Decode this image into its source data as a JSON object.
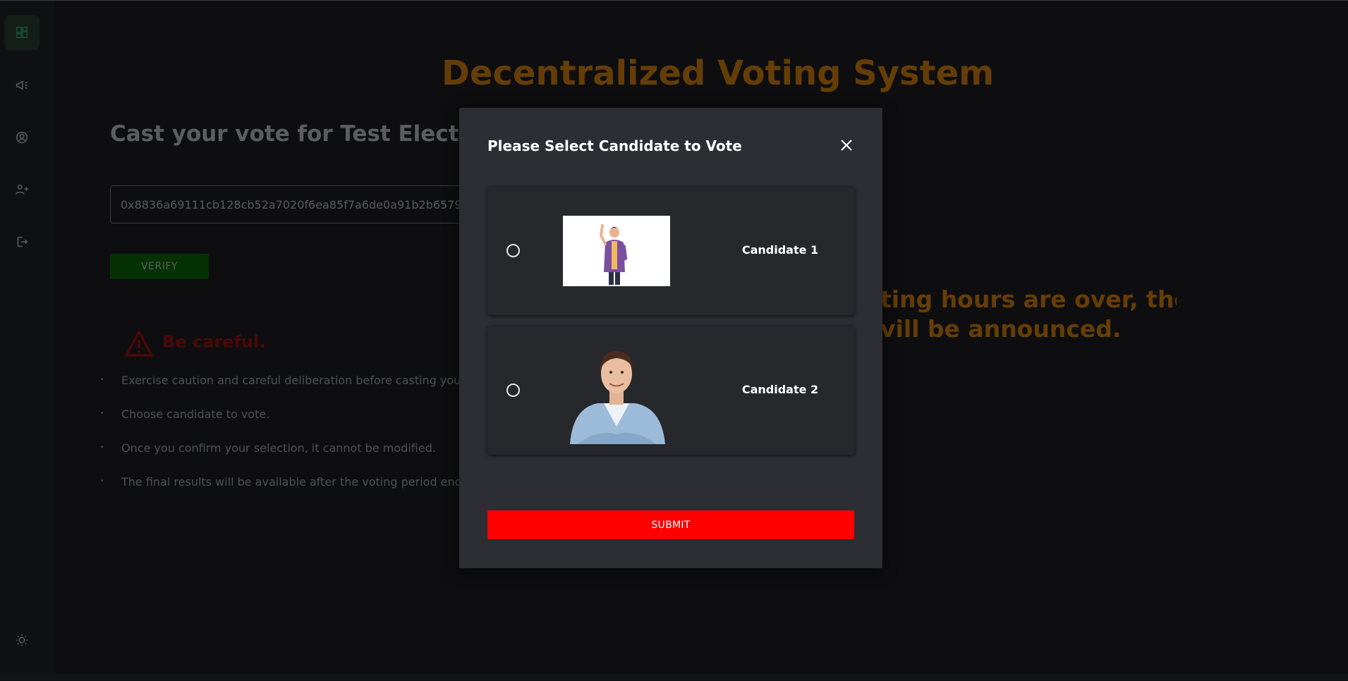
{
  "sidebar": {
    "items": [
      {
        "icon": "dashboard-icon",
        "active": true
      },
      {
        "icon": "megaphone-icon"
      },
      {
        "icon": "user-circle-icon"
      },
      {
        "icon": "add-user-icon"
      },
      {
        "icon": "logout-icon"
      }
    ],
    "theme_toggle_icon": "sun-icon"
  },
  "page": {
    "title": "Decentralized Voting System",
    "cast_title": "Cast your vote for Test Election",
    "token_value": "0x8836a69111cb128cb52a7020f6ea85f7a6de0a91b2b65791374",
    "verify_label": "VERIFY",
    "warning_text": "Be careful.",
    "rules": [
      "Exercise caution and careful deliberation before casting you",
      "Choose candidate to vote.",
      "Once you confirm your selection, it cannot be modified.",
      "The final results will be available after the voting period ends"
    ],
    "notice_line1": "ting hours are over, the",
    "notice_line2": "vill be announced."
  },
  "modal": {
    "title": "Please Select Candidate to Vote",
    "candidates": [
      {
        "name": "Candidate 1",
        "image": "candidate-1-illustration"
      },
      {
        "name": "Candidate 2",
        "image": "candidate-2-photo"
      }
    ],
    "submit_label": "SUBMIT"
  },
  "colors": {
    "background": "#1a1b1e",
    "accent_orange": "#b86f0e",
    "verify_green": "#0a5a0a",
    "warning_red": "#8a0f0f",
    "submit_red": "#ff0000",
    "modal_bg": "#2c2e33"
  }
}
